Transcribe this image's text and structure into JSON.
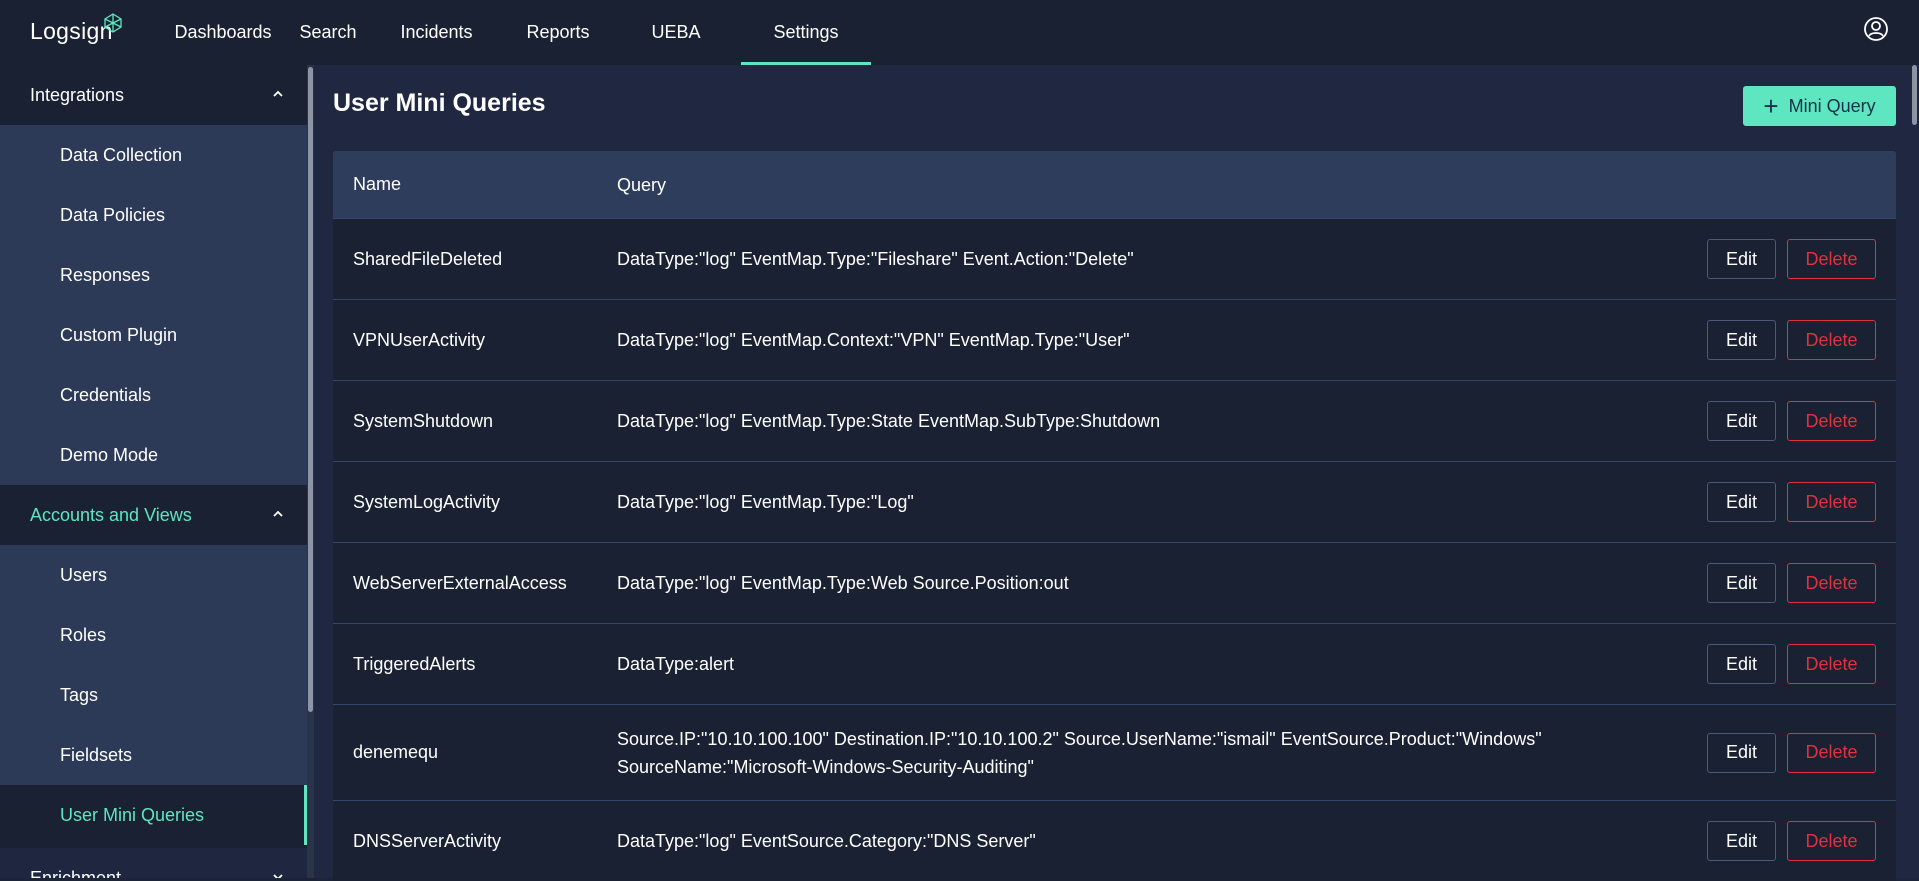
{
  "app": {
    "logo_text": "Logsign"
  },
  "nav": {
    "items": [
      {
        "label": "Dashboards"
      },
      {
        "label": "Search"
      },
      {
        "label": "Incidents"
      },
      {
        "label": "Reports"
      },
      {
        "label": "UEBA"
      },
      {
        "label": "Settings",
        "active": true
      }
    ]
  },
  "sidebar": {
    "sections": [
      {
        "label": "Integrations",
        "expanded": true,
        "items": [
          "Data Collection",
          "Data Policies",
          "Responses",
          "Custom Plugin",
          "Credentials",
          "Demo Mode"
        ]
      },
      {
        "label": "Accounts and Views",
        "expanded": true,
        "items": [
          "Users",
          "Roles",
          "Tags",
          "Fieldsets",
          "User Mini Queries"
        ]
      },
      {
        "label": "Enrichment",
        "expanded": false,
        "items": []
      }
    ],
    "active_item": "User Mini Queries"
  },
  "main": {
    "title": "User Mini Queries",
    "add_button_label": "Mini Query",
    "table": {
      "columns": [
        "Name",
        "Query"
      ],
      "edit_label": "Edit",
      "delete_label": "Delete",
      "rows": [
        {
          "name": "SharedFileDeleted",
          "query": "DataType:\"log\" EventMap.Type:\"Fileshare\" Event.Action:\"Delete\""
        },
        {
          "name": "VPNUserActivity",
          "query": "DataType:\"log\" EventMap.Context:\"VPN\" EventMap.Type:\"User\""
        },
        {
          "name": "SystemShutdown",
          "query": "DataType:\"log\" EventMap.Type:State EventMap.SubType:Shutdown"
        },
        {
          "name": "SystemLogActivity",
          "query": "DataType:\"log\" EventMap.Type:\"Log\""
        },
        {
          "name": "WebServerExternalAccess",
          "query": "DataType:\"log\" EventMap.Type:Web Source.Position:out"
        },
        {
          "name": "TriggeredAlerts",
          "query": "DataType:alert"
        },
        {
          "name": "denemequ",
          "query": "Source.IP:\"10.10.100.100\" Destination.IP:\"10.10.100.2\" Source.UserName:\"ismail\" EventSource.Product:\"Windows\" SourceName:\"Microsoft-Windows-Security-Auditing\""
        },
        {
          "name": "DNSServerActivity",
          "query": "DataType:\"log\" EventSource.Category:\"DNS Server\""
        }
      ]
    }
  },
  "colors": {
    "accent": "#5ee6c0",
    "danger": "#e0313f",
    "background": "#1a2133"
  }
}
